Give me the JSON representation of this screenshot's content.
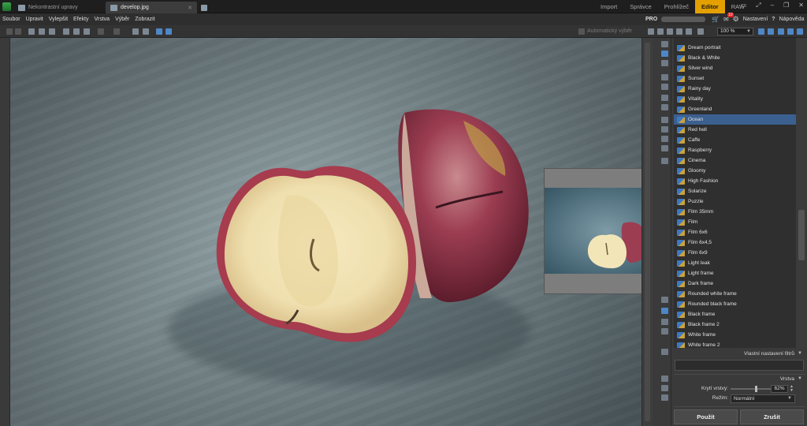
{
  "tabs": [
    {
      "label": "Nekontrastní upravy",
      "active": false
    },
    {
      "label": "develop.jpg",
      "active": true
    }
  ],
  "modes": [
    "Import",
    "Správce",
    "Prohlížeč",
    "Editor",
    "RAW"
  ],
  "active_mode": "Editor",
  "menu": [
    "Soubor",
    "Upravit",
    "Vylepšit",
    "Efekty",
    "Vrstva",
    "Výběr",
    "Zobrazit"
  ],
  "header": {
    "pro_label": "PRO",
    "notification_count": "10",
    "settings_label": "Nastavení",
    "help_label": "Nápověda"
  },
  "toolbar": {
    "auto_label": "Automatický výběr",
    "zoom_value": "100 %"
  },
  "filters": [
    "Dream portrait",
    "Black & White",
    "Silver wind",
    "Sunset",
    "Rainy day",
    "Vitality",
    "Greenland",
    "Ocean",
    "Red hell",
    "Caffe",
    "Raspberry",
    "Cinema",
    "Gloomy",
    "High Fashion",
    "Solarize",
    "Puzzle",
    "Film 35mm",
    "Film",
    "Film 6x6",
    "Film 6x4,5",
    "Film 6x9",
    "Light leak",
    "Light frame",
    "Dark frame",
    "Rounded white frame",
    "Rounded black frame",
    "Black frame",
    "Black frame 2",
    "White frame",
    "White frame 2"
  ],
  "selected_filter": "Ocean",
  "panel": {
    "custom_filter_label": "Vlastní nastavení filtrů",
    "layer_label": "Vrstva",
    "opacity_label": "Krytí vrstvy:",
    "opacity_value": "62%",
    "opacity_fraction": 0.62,
    "mode_label": "Režim:",
    "mode_value": "Normální"
  },
  "buttons": {
    "apply": "Použít",
    "cancel": "Zrušit"
  },
  "colors": {
    "accent": "#e3a000",
    "selection": "#3b5f8f"
  }
}
